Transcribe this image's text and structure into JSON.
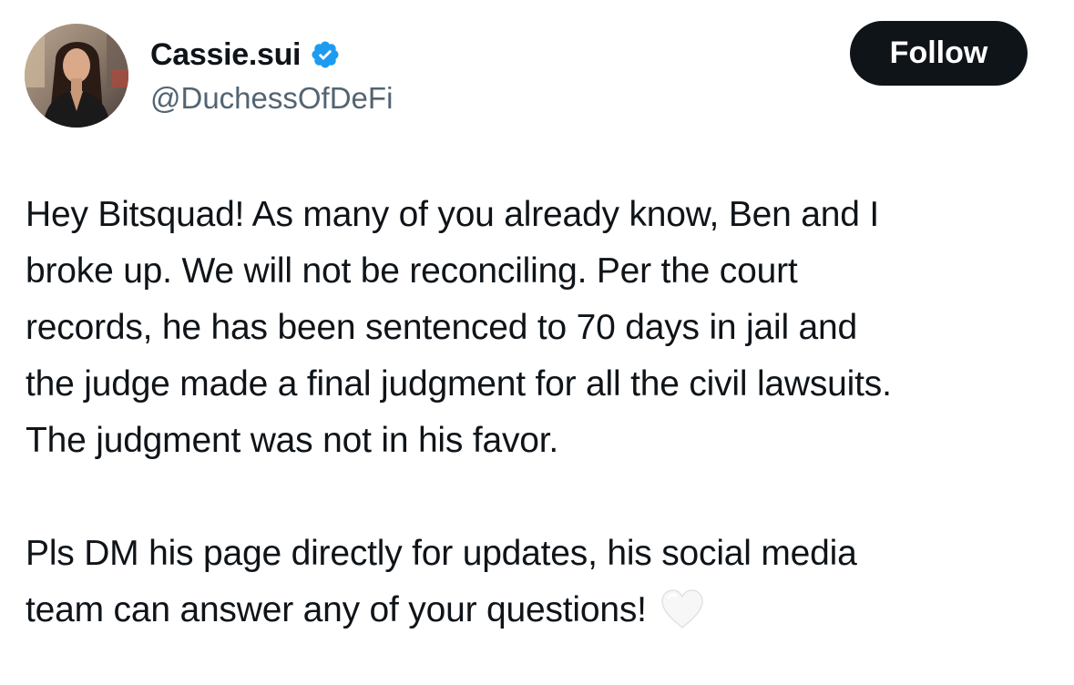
{
  "author": {
    "display_name": "Cassie.sui",
    "handle": "@DuchessOfDeFi",
    "verified": true,
    "verified_badge_color": "#1d9bf0"
  },
  "follow_button": {
    "label": "Follow"
  },
  "tweet": {
    "paragraphs": [
      {
        "lines": [
          "Hey Bitsquad! As many of you already know, Ben and I",
          "broke up. We will not be reconciling. Per the court",
          "records, he has been sentenced to 70 days in jail and",
          "the judge made a final judgment for all the civil lawsuits.",
          "The judgment was not in his favor."
        ]
      },
      {
        "lines": [
          "Pls DM his page directly for updates, his social media",
          "team can answer any of your questions!"
        ],
        "trailing_emoji": "white-heart-icon"
      }
    ]
  },
  "colors": {
    "text_primary": "#0f1419",
    "text_secondary": "#536471",
    "button_bg": "#0f1419",
    "button_text": "#ffffff"
  }
}
